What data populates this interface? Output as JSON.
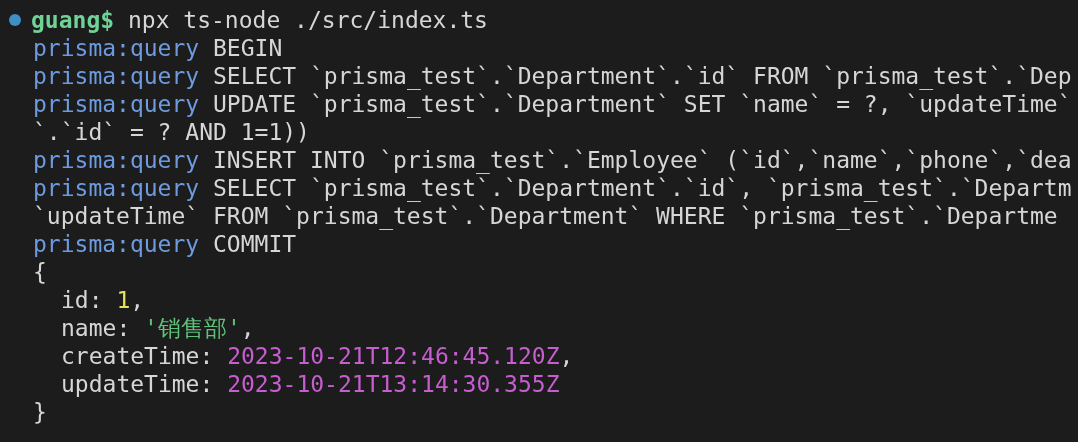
{
  "prompt": {
    "user": "guang$",
    "command": "npx ts-node ./src/index.ts"
  },
  "output": [
    {
      "kind": "query",
      "tag": "prisma:query",
      "text": "BEGIN"
    },
    {
      "kind": "query",
      "tag": "prisma:query",
      "text": "SELECT `prisma_test`.`Department`.`id` FROM `prisma_test`.`Dep"
    },
    {
      "kind": "query",
      "tag": "prisma:query",
      "text": "UPDATE `prisma_test`.`Department` SET `name` = ?, `updateTime`"
    },
    {
      "kind": "plain",
      "text": "`.`id` = ? AND 1=1))"
    },
    {
      "kind": "query",
      "tag": "prisma:query",
      "text": "INSERT INTO `prisma_test`.`Employee` (`id`,`name`,`phone`,`dea"
    },
    {
      "kind": "query",
      "tag": "prisma:query",
      "text": "SELECT `prisma_test`.`Department`.`id`, `prisma_test`.`Departm"
    },
    {
      "kind": "plain",
      "text": "`updateTime` FROM `prisma_test`.`Department` WHERE `prisma_test`.`Departme"
    },
    {
      "kind": "query",
      "tag": "prisma:query",
      "text": "COMMIT"
    }
  ],
  "result": {
    "open": "{",
    "fields": [
      {
        "key": "id:",
        "kind": "number",
        "value": "1",
        "punct": ","
      },
      {
        "key": "name:",
        "kind": "string",
        "value": "'销售部'",
        "punct": ","
      },
      {
        "key": "createTime:",
        "kind": "date",
        "value": "2023-10-21T12:46:45.120Z",
        "punct": ","
      },
      {
        "key": "updateTime:",
        "kind": "date",
        "value": "2023-10-21T13:14:30.355Z"
      }
    ],
    "close": "}"
  }
}
